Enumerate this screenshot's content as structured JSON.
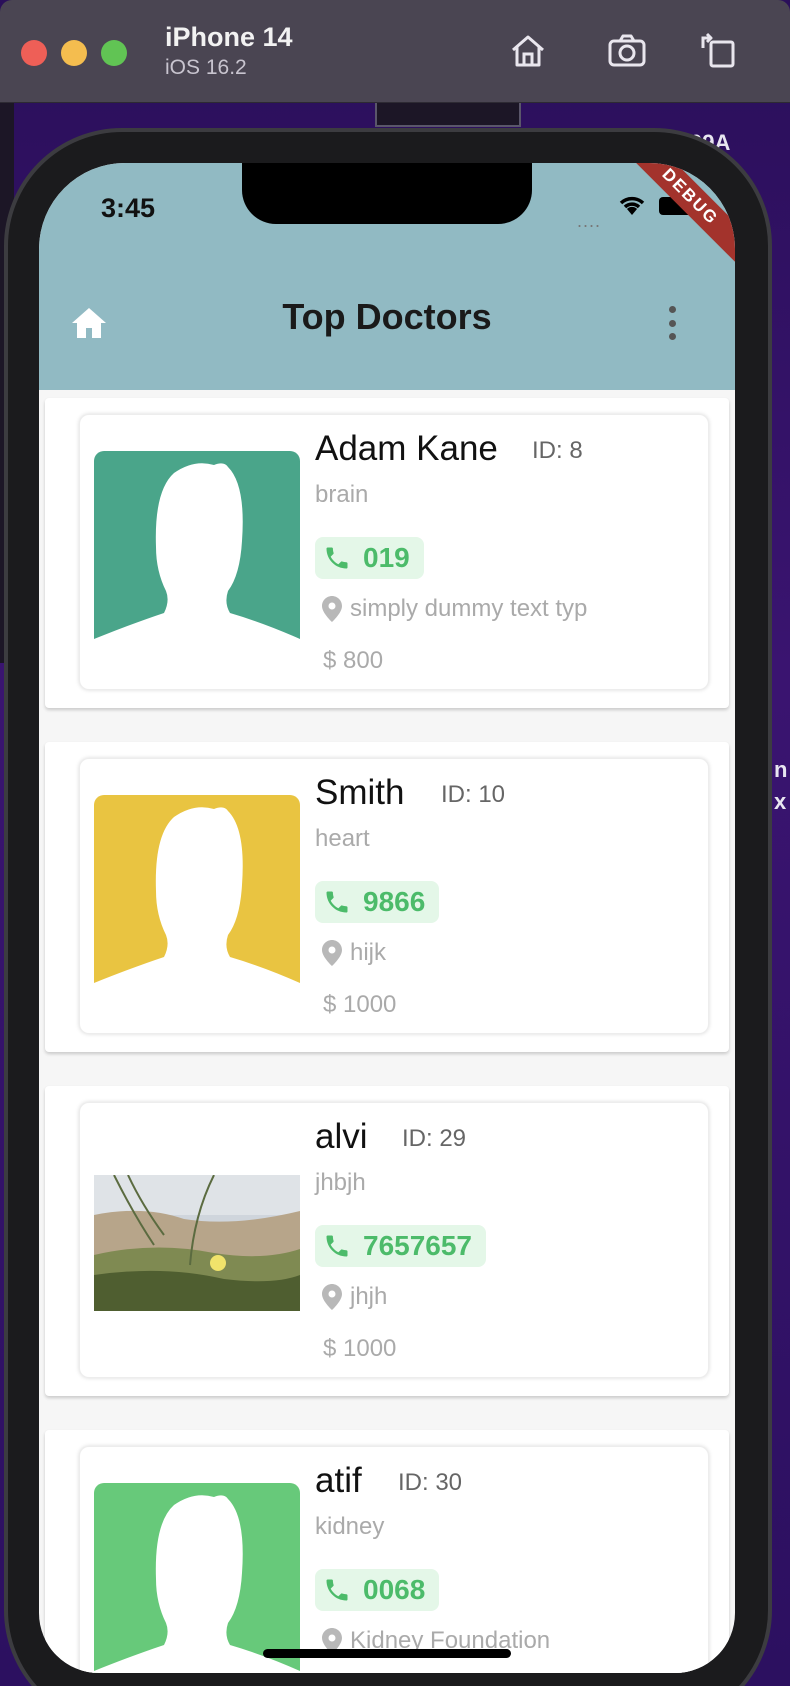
{
  "simulator": {
    "device": "iPhone 14",
    "os": "iOS 16.2",
    "buttons": [
      "home-icon",
      "screenshot-icon",
      "rotate-icon"
    ]
  },
  "background_fragments": {
    "top_right": "09A",
    "right_1": "n",
    "right_2": "x"
  },
  "status_bar": {
    "time": "3:45",
    "dots": "....",
    "debug_banner": "DEBUG"
  },
  "app_bar": {
    "title": "Top Doctors",
    "background": "#91bac3",
    "leading_icon": "home-icon",
    "trailing_icon": "more-vert-icon"
  },
  "doctors": [
    {
      "name": "Adam Kane",
      "id": "ID: 8",
      "specialty": "brain",
      "phone": "019",
      "location": "simply dummy text  typ",
      "fee": "$ 800",
      "avatar_color": "#4aa58a",
      "avatar_type": "silhouette"
    },
    {
      "name": "Smith",
      "id": "ID: 10",
      "specialty": "heart",
      "phone": "9866",
      "location": "hijk",
      "fee": "$ 1000",
      "avatar_color": "#e9c441",
      "avatar_type": "silhouette"
    },
    {
      "name": "alvi",
      "id": "ID: 29",
      "specialty": "jhbjh",
      "phone": "7657657",
      "location": "jhjh",
      "fee": "$ 1000",
      "avatar_color": "#8a9a6a",
      "avatar_type": "photo"
    },
    {
      "name": "atif",
      "id": "ID: 30",
      "specialty": "kidney",
      "phone": "0068",
      "location": "Kidney Foundation",
      "fee": "",
      "avatar_color": "#67c97a",
      "avatar_type": "silhouette"
    }
  ],
  "colors": {
    "chip_bg": "#e4f7e8",
    "chip_text": "#4cbb6a",
    "muted_text": "#aaaaaa"
  }
}
